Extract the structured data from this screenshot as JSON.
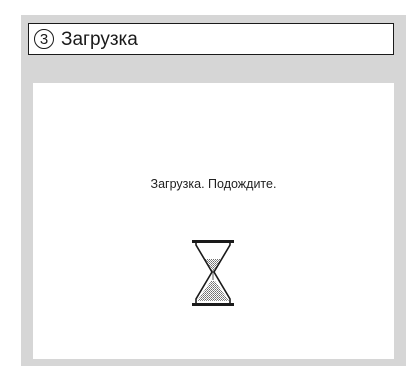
{
  "window": {
    "step_number": "3",
    "title": "Загрузка"
  },
  "content": {
    "message": "Загрузка. Подождите."
  },
  "icons": {
    "loading": "hourglass-icon"
  },
  "colors": {
    "panel_background": "#d6d6d6",
    "content_background": "#ffffff",
    "border": "#1a1a1a",
    "sand": "#8c8c8c"
  }
}
